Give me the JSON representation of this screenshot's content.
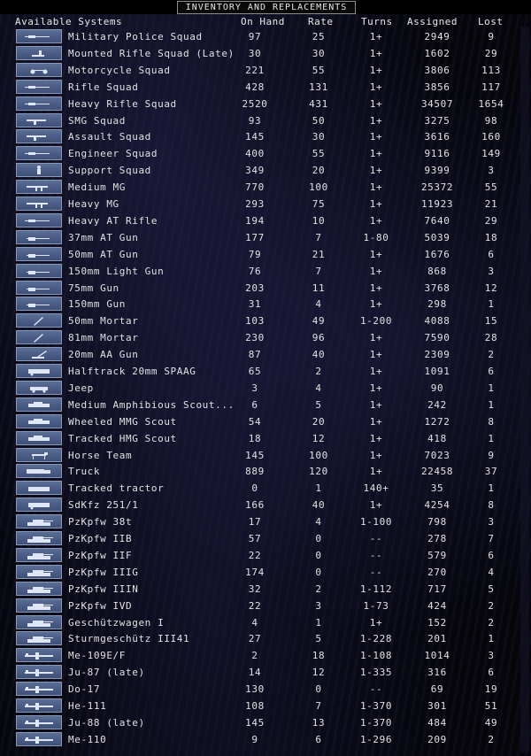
{
  "window": {
    "title": "INVENTORY AND REPLACEMENTS"
  },
  "headers": {
    "systems": "Available Systems",
    "on_hand": "On Hand",
    "rate": "Rate",
    "turns": "Turns",
    "assigned": "Assigned",
    "lost": "Lost"
  },
  "rows": [
    {
      "name": "Military Police Squad",
      "on_hand": "97",
      "rate": "25",
      "turns": "1+",
      "assigned": "2949",
      "lost": "9",
      "icon": "rifle-icon"
    },
    {
      "name": "Mounted Rifle Squad (Late)",
      "on_hand": "30",
      "rate": "30",
      "turns": "1+",
      "assigned": "1602",
      "lost": "29",
      "icon": "cavalry-icon"
    },
    {
      "name": "Motorcycle Squad",
      "on_hand": "221",
      "rate": "55",
      "turns": "1+",
      "assigned": "3806",
      "lost": "113",
      "icon": "motorcycle-icon"
    },
    {
      "name": "Rifle Squad",
      "on_hand": "428",
      "rate": "131",
      "turns": "1+",
      "assigned": "3856",
      "lost": "117",
      "icon": "rifle-icon"
    },
    {
      "name": "Heavy Rifle Squad",
      "on_hand": "2520",
      "rate": "431",
      "turns": "1+",
      "assigned": "34507",
      "lost": "1654",
      "icon": "rifle-icon"
    },
    {
      "name": "SMG Squad",
      "on_hand": "93",
      "rate": "50",
      "turns": "1+",
      "assigned": "3275",
      "lost": "98",
      "icon": "smg-icon"
    },
    {
      "name": "Assault Squad",
      "on_hand": "145",
      "rate": "30",
      "turns": "1+",
      "assigned": "3616",
      "lost": "160",
      "icon": "smg-icon"
    },
    {
      "name": "Engineer Squad",
      "on_hand": "400",
      "rate": "55",
      "turns": "1+",
      "assigned": "9116",
      "lost": "149",
      "icon": "rifle-icon"
    },
    {
      "name": "Support Squad",
      "on_hand": "349",
      "rate": "20",
      "turns": "1+",
      "assigned": "9399",
      "lost": "3",
      "icon": "soldier-icon"
    },
    {
      "name": "Medium MG",
      "on_hand": "770",
      "rate": "100",
      "turns": "1+",
      "assigned": "25372",
      "lost": "55",
      "icon": "machinegun-icon"
    },
    {
      "name": "Heavy MG",
      "on_hand": "293",
      "rate": "75",
      "turns": "1+",
      "assigned": "11923",
      "lost": "21",
      "icon": "machinegun-icon"
    },
    {
      "name": "Heavy AT Rifle",
      "on_hand": "194",
      "rate": "10",
      "turns": "1+",
      "assigned": "7640",
      "lost": "29",
      "icon": "rifle-icon"
    },
    {
      "name": "37mm AT Gun",
      "on_hand": "177",
      "rate": "7",
      "turns": "1-80",
      "assigned": "5039",
      "lost": "18",
      "icon": "field-gun-icon"
    },
    {
      "name": "50mm AT Gun",
      "on_hand": "79",
      "rate": "21",
      "turns": "1+",
      "assigned": "1676",
      "lost": "6",
      "icon": "field-gun-icon"
    },
    {
      "name": "150mm Light Gun",
      "on_hand": "76",
      "rate": "7",
      "turns": "1+",
      "assigned": "868",
      "lost": "3",
      "icon": "field-gun-icon"
    },
    {
      "name": "75mm Gun",
      "on_hand": "203",
      "rate": "11",
      "turns": "1+",
      "assigned": "3768",
      "lost": "12",
      "icon": "field-gun-icon"
    },
    {
      "name": "150mm Gun",
      "on_hand": "31",
      "rate": "4",
      "turns": "1+",
      "assigned": "298",
      "lost": "1",
      "icon": "field-gun-icon"
    },
    {
      "name": "50mm Mortar",
      "on_hand": "103",
      "rate": "49",
      "turns": "1-200",
      "assigned": "4088",
      "lost": "15",
      "icon": "mortar-icon"
    },
    {
      "name": "81mm Mortar",
      "on_hand": "230",
      "rate": "96",
      "turns": "1+",
      "assigned": "7590",
      "lost": "28",
      "icon": "mortar-icon"
    },
    {
      "name": "20mm AA Gun",
      "on_hand": "87",
      "rate": "40",
      "turns": "1+",
      "assigned": "2309",
      "lost": "2",
      "icon": "aa-gun-icon"
    },
    {
      "name": "Halftrack 20mm SPAAG",
      "on_hand": "65",
      "rate": "2",
      "turns": "1+",
      "assigned": "1091",
      "lost": "6",
      "icon": "halftrack-icon"
    },
    {
      "name": "Jeep",
      "on_hand": "3",
      "rate": "4",
      "turns": "1+",
      "assigned": "90",
      "lost": "1",
      "icon": "jeep-icon"
    },
    {
      "name": "Medium Amphibious Scout...",
      "on_hand": "6",
      "rate": "5",
      "turns": "1+",
      "assigned": "242",
      "lost": "1",
      "icon": "armored-car-icon"
    },
    {
      "name": "Wheeled MMG Scout",
      "on_hand": "54",
      "rate": "20",
      "turns": "1+",
      "assigned": "1272",
      "lost": "8",
      "icon": "armored-car-icon"
    },
    {
      "name": "Tracked HMG Scout",
      "on_hand": "18",
      "rate": "12",
      "turns": "1+",
      "assigned": "418",
      "lost": "1",
      "icon": "armored-car-icon"
    },
    {
      "name": "Horse Team",
      "on_hand": "145",
      "rate": "100",
      "turns": "1+",
      "assigned": "7023",
      "lost": "9",
      "icon": "horse-icon"
    },
    {
      "name": "Truck",
      "on_hand": "889",
      "rate": "120",
      "turns": "1+",
      "assigned": "22458",
      "lost": "37",
      "icon": "truck-icon"
    },
    {
      "name": "Tracked tractor",
      "on_hand": "0",
      "rate": "1",
      "turns": "140+",
      "assigned": "35",
      "lost": "1",
      "icon": "tractor-icon"
    },
    {
      "name": "SdKfz 251/1",
      "on_hand": "166",
      "rate": "40",
      "turns": "1+",
      "assigned": "4254",
      "lost": "8",
      "icon": "halftrack-icon"
    },
    {
      "name": "PzKpfw 38t",
      "on_hand": "17",
      "rate": "4",
      "turns": "1-100",
      "assigned": "798",
      "lost": "3",
      "icon": "tank-icon"
    },
    {
      "name": "PzKpfw IIB",
      "on_hand": "57",
      "rate": "0",
      "turns": "--",
      "assigned": "278",
      "lost": "7",
      "icon": "tank-icon"
    },
    {
      "name": "PzKpfw IIF",
      "on_hand": "22",
      "rate": "0",
      "turns": "--",
      "assigned": "579",
      "lost": "6",
      "icon": "tank-icon"
    },
    {
      "name": "PzKpfw IIIG",
      "on_hand": "174",
      "rate": "0",
      "turns": "--",
      "assigned": "270",
      "lost": "4",
      "icon": "tank-icon"
    },
    {
      "name": "PzKpfw IIIN",
      "on_hand": "32",
      "rate": "2",
      "turns": "1-112",
      "assigned": "717",
      "lost": "5",
      "icon": "tank-icon"
    },
    {
      "name": "PzKpfw IVD",
      "on_hand": "22",
      "rate": "3",
      "turns": "1-73",
      "assigned": "424",
      "lost": "2",
      "icon": "tank-icon"
    },
    {
      "name": "Geschützwagen I",
      "on_hand": "4",
      "rate": "1",
      "turns": "1+",
      "assigned": "152",
      "lost": "2",
      "icon": "tank-icon"
    },
    {
      "name": "Sturmgeschütz III41",
      "on_hand": "27",
      "rate": "5",
      "turns": "1-228",
      "assigned": "201",
      "lost": "1",
      "icon": "tank-icon"
    },
    {
      "name": "Me-109E/F",
      "on_hand": "2",
      "rate": "18",
      "turns": "1-108",
      "assigned": "1014",
      "lost": "3",
      "icon": "aircraft-icon"
    },
    {
      "name": "Ju-87 (late)",
      "on_hand": "14",
      "rate": "12",
      "turns": "1-335",
      "assigned": "316",
      "lost": "6",
      "icon": "aircraft-icon"
    },
    {
      "name": "Do-17",
      "on_hand": "130",
      "rate": "0",
      "turns": "--",
      "assigned": "69",
      "lost": "19",
      "icon": "aircraft-icon"
    },
    {
      "name": "He-111",
      "on_hand": "108",
      "rate": "7",
      "turns": "1-370",
      "assigned": "301",
      "lost": "51",
      "icon": "aircraft-icon"
    },
    {
      "name": "Ju-88 (late)",
      "on_hand": "145",
      "rate": "13",
      "turns": "1-370",
      "assigned": "484",
      "lost": "49",
      "icon": "aircraft-icon"
    },
    {
      "name": "Me-110",
      "on_hand": "9",
      "rate": "6",
      "turns": "1-296",
      "assigned": "209",
      "lost": "2",
      "icon": "aircraft-icon"
    }
  ]
}
